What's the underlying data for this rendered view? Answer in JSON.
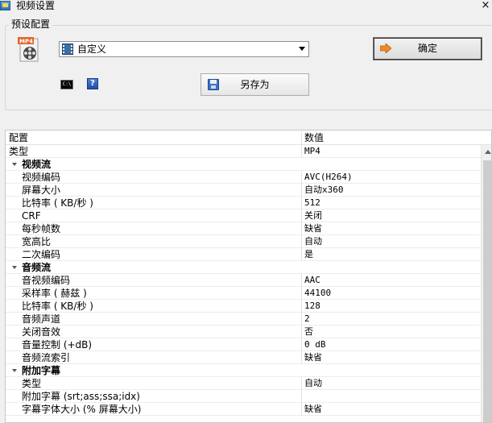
{
  "window": {
    "title": "视频设置",
    "close_glyph": "×"
  },
  "preset": {
    "group_label": "预设配置",
    "selected_value": "自定义",
    "confirm_label": "确定",
    "save_as_label": "另存为",
    "cmd_icon_text": "C:\\",
    "help_icon_text": "?"
  },
  "grid": {
    "header_name": "配置",
    "header_value": "数值",
    "rows": [
      {
        "kind": "top",
        "name": "类型",
        "value": "MP4"
      },
      {
        "kind": "cat",
        "name": "视频流",
        "value": ""
      },
      {
        "kind": "prop",
        "name": "视频编码",
        "value": "AVC(H264)"
      },
      {
        "kind": "prop",
        "name": "屏幕大小",
        "value": "自动x360"
      },
      {
        "kind": "prop",
        "name": "比特率 ( KB/秒 )",
        "value": "512"
      },
      {
        "kind": "prop",
        "name": "CRF",
        "value": "关闭"
      },
      {
        "kind": "prop",
        "name": "每秒帧数",
        "value": "缺省"
      },
      {
        "kind": "prop",
        "name": "宽高比",
        "value": "自动"
      },
      {
        "kind": "prop",
        "name": "二次编码",
        "value": "是"
      },
      {
        "kind": "cat",
        "name": "音频流",
        "value": ""
      },
      {
        "kind": "prop",
        "name": "音视频编码",
        "value": "AAC"
      },
      {
        "kind": "prop",
        "name": "采样率 ( 赫兹 )",
        "value": "44100"
      },
      {
        "kind": "prop",
        "name": "比特率 ( KB/秒 )",
        "value": "128"
      },
      {
        "kind": "prop",
        "name": "音频声道",
        "value": "2"
      },
      {
        "kind": "prop",
        "name": "关闭音效",
        "value": "否"
      },
      {
        "kind": "prop",
        "name": "音量控制 (+dB)",
        "value": "0 dB"
      },
      {
        "kind": "prop",
        "name": "音频流索引",
        "value": "缺省"
      },
      {
        "kind": "cat",
        "name": "附加字幕",
        "value": ""
      },
      {
        "kind": "prop",
        "name": "类型",
        "value": "自动"
      },
      {
        "kind": "prop",
        "name": "附加字幕 (srt;ass;ssa;idx)",
        "value": ""
      },
      {
        "kind": "prop",
        "name": "字幕字体大小 (% 屏幕大小)",
        "value": "缺省"
      }
    ]
  },
  "colors": {
    "window_bg": "#f0f0f0",
    "grid_bg": "#ffffff",
    "confirm_arrow": "#f08a24"
  }
}
